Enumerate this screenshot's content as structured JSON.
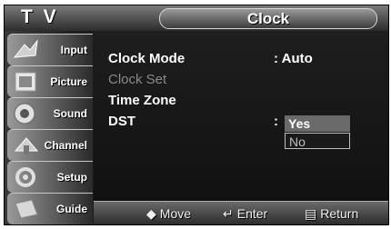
{
  "header": {
    "tv_label": "T V",
    "title": "Clock"
  },
  "sidebar": {
    "items": [
      {
        "label": "Input",
        "icon": "input-icon"
      },
      {
        "label": "Picture",
        "icon": "picture-icon"
      },
      {
        "label": "Sound",
        "icon": "sound-icon"
      },
      {
        "label": "Channel",
        "icon": "channel-icon"
      },
      {
        "label": "Setup",
        "icon": "setup-icon"
      },
      {
        "label": "Guide",
        "icon": "guide-icon"
      }
    ]
  },
  "menu": {
    "rows": [
      {
        "label": "Clock Mode",
        "value": ": Auto",
        "enabled": true
      },
      {
        "label": "Clock Set",
        "value": "",
        "enabled": false
      },
      {
        "label": "Time Zone",
        "value": "",
        "enabled": true
      },
      {
        "label": "DST",
        "value": ":",
        "enabled": true
      }
    ],
    "dst_options": {
      "selected": "Yes",
      "other": "No"
    }
  },
  "footer": {
    "move": "Move",
    "move_icon": "move-arrows-icon",
    "enter": "Enter",
    "enter_icon": "enter-icon",
    "return": "Return",
    "return_icon": "return-icon"
  }
}
